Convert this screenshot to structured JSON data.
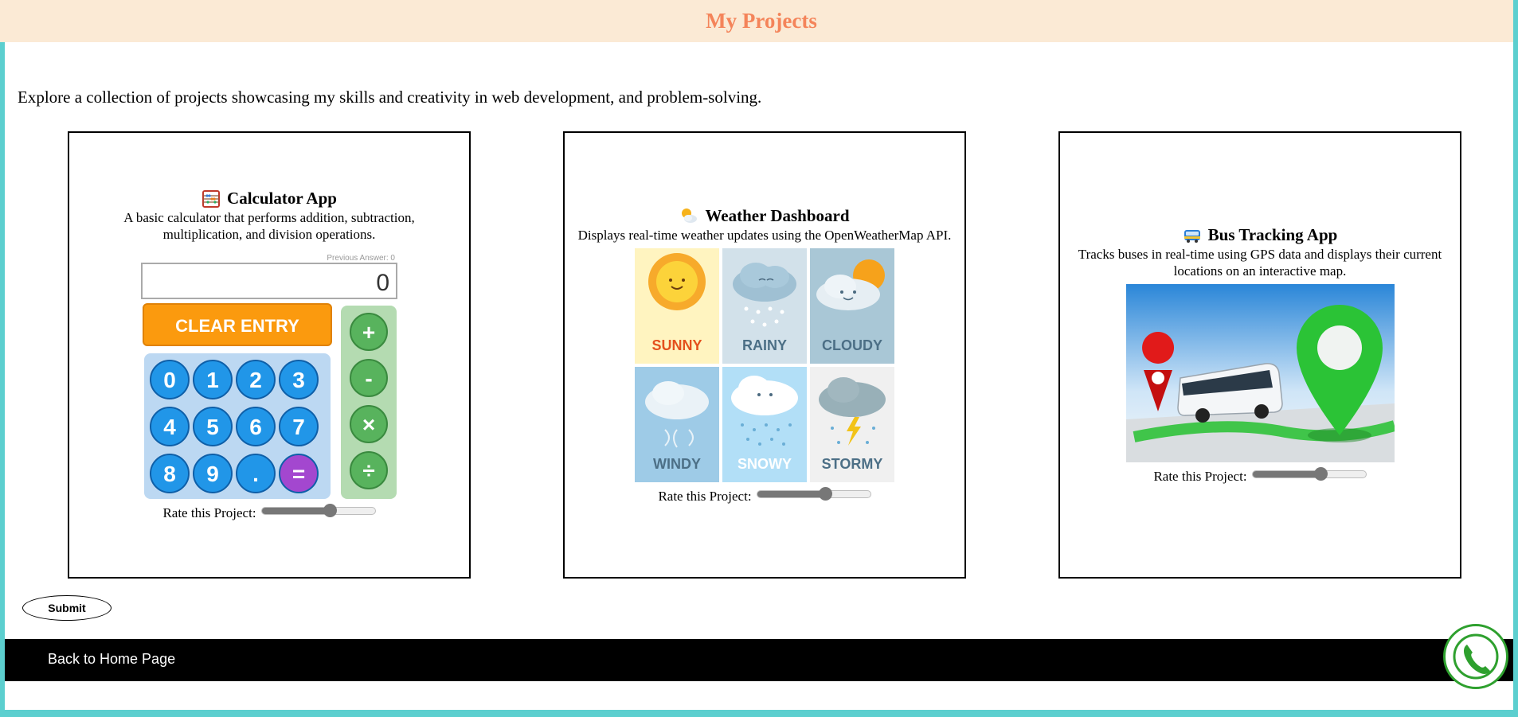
{
  "header": {
    "title": "My Projects"
  },
  "intro": "Explore a collection of projects showcasing my skills and creativity in web development, and problem-solving.",
  "projects": [
    {
      "title": "Calculator App",
      "icon": "abacus-icon",
      "description": "A basic calculator that performs addition, subtraction, multiplication, and division operations.",
      "rating_label": "Rate this Project:",
      "rating_value": 0.6,
      "image": {
        "previous_answer": "Previous Answer: 0",
        "display": "0",
        "clear_label": "CLEAR ENTRY",
        "keys": [
          "0",
          "1",
          "2",
          "3",
          "4",
          "5",
          "6",
          "7",
          "8",
          "9",
          ".",
          "="
        ],
        "ops": [
          "+",
          "-",
          "×",
          "÷"
        ]
      }
    },
    {
      "title": "Weather Dashboard",
      "icon": "sun-behind-cloud-icon",
      "description": "Displays real-time weather updates using the OpenWeatherMap API.",
      "rating_label": "Rate this Project:",
      "rating_value": 0.6,
      "image": {
        "tiles": [
          "SUNNY",
          "RAINY",
          "CLOUDY",
          "WINDY",
          "SNOWY",
          "STORMY"
        ]
      }
    },
    {
      "title": "Bus Tracking App",
      "icon": "bus-icon",
      "description": "Tracks buses in real-time using GPS data and displays their current locations on an interactive map.",
      "rating_label": "Rate this Project:",
      "rating_value": 0.6
    }
  ],
  "submit_label": "Submit",
  "footer": {
    "link": "Back to Home Page"
  },
  "colors": {
    "accent": "#f4845a",
    "header_bg": "#fbead5",
    "frame": "#5ccfcf",
    "phone": "#2ea02e"
  }
}
